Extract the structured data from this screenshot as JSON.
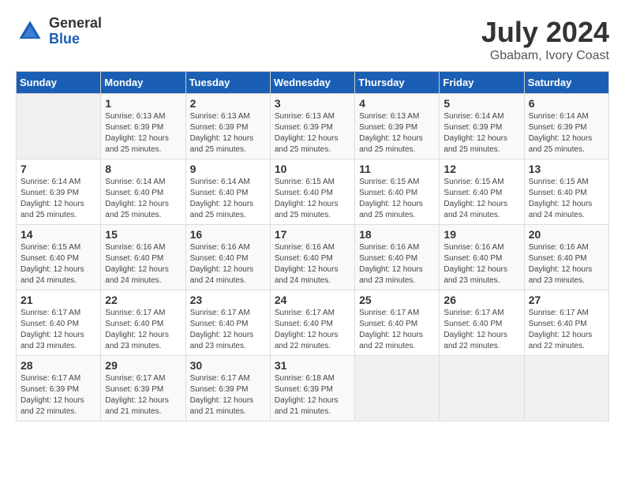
{
  "header": {
    "logo_general": "General",
    "logo_blue": "Blue",
    "title": "July 2024",
    "subtitle": "Gbabam, Ivory Coast"
  },
  "calendar": {
    "days_of_week": [
      "Sunday",
      "Monday",
      "Tuesday",
      "Wednesday",
      "Thursday",
      "Friday",
      "Saturday"
    ],
    "weeks": [
      [
        {
          "day": "",
          "info": ""
        },
        {
          "day": "1",
          "info": "Sunrise: 6:13 AM\nSunset: 6:39 PM\nDaylight: 12 hours\nand 25 minutes."
        },
        {
          "day": "2",
          "info": "Sunrise: 6:13 AM\nSunset: 6:39 PM\nDaylight: 12 hours\nand 25 minutes."
        },
        {
          "day": "3",
          "info": "Sunrise: 6:13 AM\nSunset: 6:39 PM\nDaylight: 12 hours\nand 25 minutes."
        },
        {
          "day": "4",
          "info": "Sunrise: 6:13 AM\nSunset: 6:39 PM\nDaylight: 12 hours\nand 25 minutes."
        },
        {
          "day": "5",
          "info": "Sunrise: 6:14 AM\nSunset: 6:39 PM\nDaylight: 12 hours\nand 25 minutes."
        },
        {
          "day": "6",
          "info": "Sunrise: 6:14 AM\nSunset: 6:39 PM\nDaylight: 12 hours\nand 25 minutes."
        }
      ],
      [
        {
          "day": "7",
          "info": "Sunrise: 6:14 AM\nSunset: 6:39 PM\nDaylight: 12 hours\nand 25 minutes."
        },
        {
          "day": "8",
          "info": "Sunrise: 6:14 AM\nSunset: 6:40 PM\nDaylight: 12 hours\nand 25 minutes."
        },
        {
          "day": "9",
          "info": "Sunrise: 6:14 AM\nSunset: 6:40 PM\nDaylight: 12 hours\nand 25 minutes."
        },
        {
          "day": "10",
          "info": "Sunrise: 6:15 AM\nSunset: 6:40 PM\nDaylight: 12 hours\nand 25 minutes."
        },
        {
          "day": "11",
          "info": "Sunrise: 6:15 AM\nSunset: 6:40 PM\nDaylight: 12 hours\nand 25 minutes."
        },
        {
          "day": "12",
          "info": "Sunrise: 6:15 AM\nSunset: 6:40 PM\nDaylight: 12 hours\nand 24 minutes."
        },
        {
          "day": "13",
          "info": "Sunrise: 6:15 AM\nSunset: 6:40 PM\nDaylight: 12 hours\nand 24 minutes."
        }
      ],
      [
        {
          "day": "14",
          "info": "Sunrise: 6:15 AM\nSunset: 6:40 PM\nDaylight: 12 hours\nand 24 minutes."
        },
        {
          "day": "15",
          "info": "Sunrise: 6:16 AM\nSunset: 6:40 PM\nDaylight: 12 hours\nand 24 minutes."
        },
        {
          "day": "16",
          "info": "Sunrise: 6:16 AM\nSunset: 6:40 PM\nDaylight: 12 hours\nand 24 minutes."
        },
        {
          "day": "17",
          "info": "Sunrise: 6:16 AM\nSunset: 6:40 PM\nDaylight: 12 hours\nand 24 minutes."
        },
        {
          "day": "18",
          "info": "Sunrise: 6:16 AM\nSunset: 6:40 PM\nDaylight: 12 hours\nand 23 minutes."
        },
        {
          "day": "19",
          "info": "Sunrise: 6:16 AM\nSunset: 6:40 PM\nDaylight: 12 hours\nand 23 minutes."
        },
        {
          "day": "20",
          "info": "Sunrise: 6:16 AM\nSunset: 6:40 PM\nDaylight: 12 hours\nand 23 minutes."
        }
      ],
      [
        {
          "day": "21",
          "info": "Sunrise: 6:17 AM\nSunset: 6:40 PM\nDaylight: 12 hours\nand 23 minutes."
        },
        {
          "day": "22",
          "info": "Sunrise: 6:17 AM\nSunset: 6:40 PM\nDaylight: 12 hours\nand 23 minutes."
        },
        {
          "day": "23",
          "info": "Sunrise: 6:17 AM\nSunset: 6:40 PM\nDaylight: 12 hours\nand 23 minutes."
        },
        {
          "day": "24",
          "info": "Sunrise: 6:17 AM\nSunset: 6:40 PM\nDaylight: 12 hours\nand 22 minutes."
        },
        {
          "day": "25",
          "info": "Sunrise: 6:17 AM\nSunset: 6:40 PM\nDaylight: 12 hours\nand 22 minutes."
        },
        {
          "day": "26",
          "info": "Sunrise: 6:17 AM\nSunset: 6:40 PM\nDaylight: 12 hours\nand 22 minutes."
        },
        {
          "day": "27",
          "info": "Sunrise: 6:17 AM\nSunset: 6:40 PM\nDaylight: 12 hours\nand 22 minutes."
        }
      ],
      [
        {
          "day": "28",
          "info": "Sunrise: 6:17 AM\nSunset: 6:39 PM\nDaylight: 12 hours\nand 22 minutes."
        },
        {
          "day": "29",
          "info": "Sunrise: 6:17 AM\nSunset: 6:39 PM\nDaylight: 12 hours\nand 21 minutes."
        },
        {
          "day": "30",
          "info": "Sunrise: 6:17 AM\nSunset: 6:39 PM\nDaylight: 12 hours\nand 21 minutes."
        },
        {
          "day": "31",
          "info": "Sunrise: 6:18 AM\nSunset: 6:39 PM\nDaylight: 12 hours\nand 21 minutes."
        },
        {
          "day": "",
          "info": ""
        },
        {
          "day": "",
          "info": ""
        },
        {
          "day": "",
          "info": ""
        }
      ]
    ]
  }
}
